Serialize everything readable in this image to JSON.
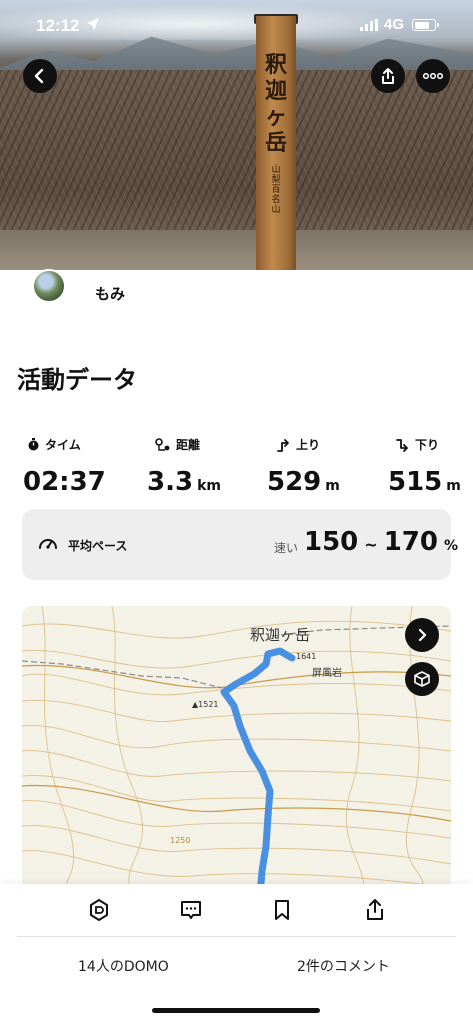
{
  "status_bar": {
    "time": "12:12",
    "network": "4G",
    "battery_level": 0.8
  },
  "hero": {
    "signpost_text": "釈迦ヶ岳",
    "signpost_subtext": "山梨百名山"
  },
  "user": {
    "name": "もみ"
  },
  "section_title": "活動データ",
  "stats": [
    {
      "label": "タイム",
      "value": "02:37",
      "unit": "",
      "icon": "stopwatch-icon"
    },
    {
      "label": "距離",
      "value": "3.3",
      "unit": "km",
      "icon": "route-pin-icon"
    },
    {
      "label": "上り",
      "value": "529",
      "unit": "m",
      "icon": "ascent-arrow-icon"
    },
    {
      "label": "下り",
      "value": "515",
      "unit": "m",
      "icon": "descent-arrow-icon"
    }
  ],
  "pace": {
    "label": "平均ペース",
    "qualifier": "速い",
    "low": "150",
    "sep": "~",
    "high": "170",
    "unit": "%"
  },
  "map": {
    "peak_name": "釈迦ヶ岳",
    "elevation_peak": "1641",
    "rock_name": "屏風岩",
    "elevation_point": "▲1521",
    "contour_label": "1250",
    "route_color": "#4a90e2"
  },
  "footer": {
    "domo_count": "14人のDOMO",
    "comment_count": "2件のコメント"
  }
}
